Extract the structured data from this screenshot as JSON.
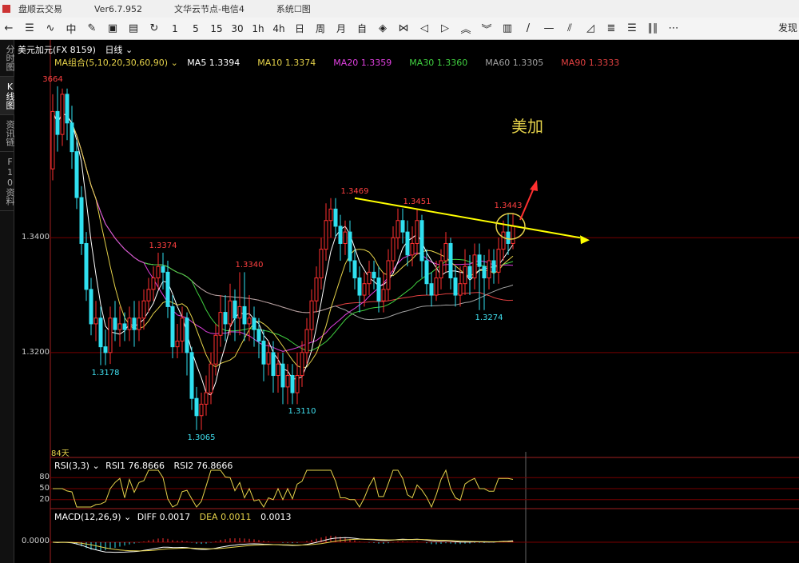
{
  "titlebar": {
    "app_title": "盘顺云交易",
    "version": "Ver6.7.952",
    "server": "文华云节点-电信4",
    "menu": "系统☐图"
  },
  "toolbar": {
    "buttons": [
      {
        "name": "back-button",
        "label": "←"
      },
      {
        "name": "list-button",
        "label": "☰"
      },
      {
        "name": "line-chart-button",
        "label": "∿"
      },
      {
        "name": "candle-button",
        "label": "中"
      },
      {
        "name": "draw-button",
        "label": "✎"
      },
      {
        "name": "screen-button",
        "label": "▣"
      },
      {
        "name": "save-button",
        "label": "▤"
      },
      {
        "name": "refresh-button",
        "label": "↻"
      }
    ],
    "periods": [
      "1",
      "5",
      "15",
      "30",
      "1h",
      "4h",
      "日",
      "周",
      "月",
      "自"
    ],
    "tools": [
      {
        "name": "crosshair-button",
        "label": "◈"
      },
      {
        "name": "split-button",
        "label": "⋈"
      },
      {
        "name": "left-button",
        "label": "◁"
      },
      {
        "name": "right-button",
        "label": "▷"
      },
      {
        "name": "up-button",
        "label": "︽"
      },
      {
        "name": "down-button",
        "label": "︾"
      },
      {
        "name": "layout-button",
        "label": "▥"
      },
      {
        "name": "line-tool-button",
        "label": "/"
      },
      {
        "name": "hline-tool-button",
        "label": "—"
      },
      {
        "name": "channel-tool-button",
        "label": "⫽"
      },
      {
        "name": "fib-tool-button",
        "label": "◿"
      },
      {
        "name": "grid-tool-button",
        "label": "≣"
      },
      {
        "name": "lines-tool-button",
        "label": "☰"
      },
      {
        "name": "bars-tool-button",
        "label": "∥∥"
      },
      {
        "name": "more-button",
        "label": "⋯"
      }
    ],
    "right_label": "发现"
  },
  "sidetabs": [
    {
      "label": "分时图",
      "active": false
    },
    {
      "label": "K线图",
      "active": true
    },
    {
      "label": "资讯链",
      "active": false
    },
    {
      "label": "F10资料",
      "active": false
    }
  ],
  "header": {
    "symbol": "美元加元(FX 8159)",
    "period": "日线",
    "ma_group": "MA组合(5,10,20,30,60,90)",
    "ma_items": [
      {
        "label": "MA5 1.3394",
        "color": "#ffffff"
      },
      {
        "label": "MA10 1.3374",
        "color": "#e5d24a"
      },
      {
        "label": "MA20 1.3359",
        "color": "#e040e0"
      },
      {
        "label": "MA30 1.3360",
        "color": "#40d040"
      },
      {
        "label": "MA60 1.3305",
        "color": "#a0a0a0"
      },
      {
        "label": "MA90 1.3333",
        "color": "#e04040"
      }
    ]
  },
  "annotation": {
    "title": "美加",
    "days": "84天"
  },
  "rsi": {
    "label": "RSI(3,3)",
    "rsi1": "RSI1 76.8666",
    "rsi2": "RSI2 76.8666",
    "ticks": [
      "80",
      "50",
      "20"
    ]
  },
  "macd": {
    "label": "MACD(12,26,9)",
    "diff": "DIFF 0.0017",
    "dea": "DEA 0.0011",
    "macd": "0.0013",
    "zero": "0.0000"
  },
  "chart_data": {
    "type": "candlestick",
    "y_ticks": [
      1.34,
      1.32
    ],
    "y_tick_labels": [
      "1.3400",
      "1.3200"
    ],
    "ylim": [
      1.302,
      1.37
    ],
    "price_labels": [
      {
        "text": "3664",
        "index": 0,
        "value": 1.3664,
        "pos": "top",
        "color": "#ff4040"
      },
      {
        "text": "1.3178",
        "index": 11,
        "value": 1.3178,
        "pos": "bottom",
        "color": "#40e0f0"
      },
      {
        "text": "1.3374",
        "index": 23,
        "value": 1.3374,
        "pos": "top",
        "color": "#ff4040"
      },
      {
        "text": "1.3065",
        "index": 31,
        "value": 1.3065,
        "pos": "bottom",
        "color": "#40e0f0"
      },
      {
        "text": "1.3340",
        "index": 41,
        "value": 1.334,
        "pos": "top",
        "color": "#ff4040"
      },
      {
        "text": "1.3110",
        "index": 52,
        "value": 1.311,
        "pos": "bottom",
        "color": "#40e0f0"
      },
      {
        "text": "1.3469",
        "index": 63,
        "value": 1.3469,
        "pos": "top",
        "color": "#ff4040"
      },
      {
        "text": "1.3451",
        "index": 76,
        "value": 1.3451,
        "pos": "top",
        "color": "#ff4040"
      },
      {
        "text": "1.3274",
        "index": 91,
        "value": 1.3274,
        "pos": "bottom",
        "color": "#40e0f0"
      },
      {
        "text": "1.3443",
        "index": 95,
        "value": 1.3443,
        "pos": "top",
        "color": "#ff4040"
      }
    ],
    "candles": [
      [
        1.352,
        1.362,
        1.365,
        1.35
      ],
      [
        1.362,
        1.358,
        1.3664,
        1.355
      ],
      [
        1.358,
        1.365,
        1.366,
        1.356
      ],
      [
        1.365,
        1.36,
        1.366,
        1.357
      ],
      [
        1.36,
        1.355,
        1.363,
        1.352
      ],
      [
        1.355,
        1.347,
        1.357,
        1.345
      ],
      [
        1.347,
        1.339,
        1.349,
        1.337
      ],
      [
        1.339,
        1.331,
        1.341,
        1.329
      ],
      [
        1.331,
        1.325,
        1.333,
        1.323
      ],
      [
        1.325,
        1.326,
        1.329,
        1.322
      ],
      [
        1.326,
        1.321,
        1.328,
        1.3178
      ],
      [
        1.321,
        1.32,
        1.324,
        1.3178
      ],
      [
        1.32,
        1.326,
        1.328,
        1.318
      ],
      [
        1.326,
        1.324,
        1.329,
        1.322
      ],
      [
        1.324,
        1.325,
        1.328,
        1.321
      ],
      [
        1.325,
        1.324,
        1.327,
        1.322
      ],
      [
        1.324,
        1.326,
        1.328,
        1.322
      ],
      [
        1.326,
        1.324,
        1.329,
        1.321
      ],
      [
        1.324,
        1.326,
        1.329,
        1.322
      ],
      [
        1.326,
        1.329,
        1.331,
        1.324
      ],
      [
        1.329,
        1.331,
        1.333,
        1.327
      ],
      [
        1.331,
        1.333,
        1.335,
        1.329
      ],
      [
        1.333,
        1.335,
        1.3374,
        1.331
      ],
      [
        1.335,
        1.334,
        1.3374,
        1.331
      ],
      [
        1.334,
        1.328,
        1.336,
        1.326
      ],
      [
        1.328,
        1.321,
        1.33,
        1.319
      ],
      [
        1.321,
        1.322,
        1.325,
        1.319
      ],
      [
        1.322,
        1.326,
        1.328,
        1.32
      ],
      [
        1.326,
        1.32,
        1.327,
        1.316
      ],
      [
        1.32,
        1.312,
        1.321,
        1.31
      ],
      [
        1.312,
        1.309,
        1.314,
        1.3065
      ],
      [
        1.309,
        1.311,
        1.313,
        1.3065
      ],
      [
        1.311,
        1.313,
        1.316,
        1.309
      ],
      [
        1.313,
        1.318,
        1.32,
        1.311
      ],
      [
        1.318,
        1.323,
        1.325,
        1.316
      ],
      [
        1.323,
        1.327,
        1.33,
        1.321
      ],
      [
        1.327,
        1.325,
        1.33,
        1.322
      ],
      [
        1.325,
        1.329,
        1.332,
        1.323
      ],
      [
        1.329,
        1.326,
        1.331,
        1.322
      ],
      [
        1.326,
        1.328,
        1.334,
        1.323
      ],
      [
        1.328,
        1.325,
        1.334,
        1.322
      ],
      [
        1.325,
        1.326,
        1.33,
        1.322
      ],
      [
        1.326,
        1.324,
        1.328,
        1.321
      ],
      [
        1.324,
        1.322,
        1.326,
        1.319
      ],
      [
        1.322,
        1.318,
        1.324,
        1.315
      ],
      [
        1.318,
        1.32,
        1.322,
        1.316
      ],
      [
        1.32,
        1.316,
        1.322,
        1.313
      ],
      [
        1.316,
        1.318,
        1.32,
        1.313
      ],
      [
        1.318,
        1.314,
        1.32,
        1.311
      ],
      [
        1.314,
        1.316,
        1.318,
        1.311
      ],
      [
        1.316,
        1.313,
        1.318,
        1.311
      ],
      [
        1.313,
        1.316,
        1.32,
        1.311
      ],
      [
        1.316,
        1.32,
        1.322,
        1.314
      ],
      [
        1.32,
        1.324,
        1.326,
        1.318
      ],
      [
        1.324,
        1.329,
        1.331,
        1.322
      ],
      [
        1.329,
        1.333,
        1.335,
        1.327
      ],
      [
        1.333,
        1.338,
        1.34,
        1.331
      ],
      [
        1.338,
        1.343,
        1.346,
        1.336
      ],
      [
        1.343,
        1.345,
        1.3469,
        1.34
      ],
      [
        1.345,
        1.342,
        1.3469,
        1.34
      ],
      [
        1.342,
        1.339,
        1.344,
        1.336
      ],
      [
        1.339,
        1.341,
        1.343,
        1.337
      ],
      [
        1.341,
        1.336,
        1.343,
        1.334
      ],
      [
        1.336,
        1.333,
        1.338,
        1.331
      ],
      [
        1.333,
        1.33,
        1.335,
        1.327
      ],
      [
        1.33,
        1.332,
        1.334,
        1.328
      ],
      [
        1.332,
        1.334,
        1.336,
        1.33
      ],
      [
        1.334,
        1.333,
        1.336,
        1.331
      ],
      [
        1.333,
        1.329,
        1.335,
        1.327
      ],
      [
        1.329,
        1.331,
        1.334,
        1.327
      ],
      [
        1.331,
        1.336,
        1.338,
        1.329
      ],
      [
        1.336,
        1.34,
        1.342,
        1.334
      ],
      [
        1.34,
        1.343,
        1.3451,
        1.338
      ],
      [
        1.343,
        1.341,
        1.3451,
        1.339
      ],
      [
        1.341,
        1.337,
        1.343,
        1.335
      ],
      [
        1.337,
        1.339,
        1.342,
        1.335
      ],
      [
        1.339,
        1.343,
        1.3451,
        1.337
      ],
      [
        1.343,
        1.336,
        1.344,
        1.333
      ],
      [
        1.336,
        1.332,
        1.338,
        1.33
      ],
      [
        1.332,
        1.33,
        1.334,
        1.328
      ],
      [
        1.33,
        1.333,
        1.336,
        1.329
      ],
      [
        1.333,
        1.336,
        1.338,
        1.331
      ],
      [
        1.336,
        1.339,
        1.341,
        1.334
      ],
      [
        1.339,
        1.333,
        1.34,
        1.331
      ],
      [
        1.333,
        1.33,
        1.335,
        1.328
      ],
      [
        1.33,
        1.332,
        1.335,
        1.328
      ],
      [
        1.332,
        1.335,
        1.338,
        1.33
      ],
      [
        1.335,
        1.333,
        1.337,
        1.33
      ],
      [
        1.333,
        1.337,
        1.339,
        1.331
      ],
      [
        1.337,
        1.335,
        1.339,
        1.3274
      ],
      [
        1.335,
        1.333,
        1.337,
        1.3274
      ],
      [
        1.333,
        1.336,
        1.338,
        1.331
      ],
      [
        1.336,
        1.334,
        1.338,
        1.332
      ],
      [
        1.334,
        1.338,
        1.34,
        1.332
      ],
      [
        1.338,
        1.341,
        1.343,
        1.336
      ],
      [
        1.341,
        1.339,
        1.3443,
        1.337
      ],
      [
        1.339,
        1.342,
        1.3443,
        1.338
      ]
    ],
    "trendline": {
      "from_index": 63,
      "from_value": 1.3469,
      "to_index": 110,
      "to_value": 1.34,
      "color": "#ffff00"
    },
    "ma_colors": {
      "ma5": "#ffffff",
      "ma10": "#e5d24a",
      "ma20": "#e040e0",
      "ma30": "#40d040",
      "ma60": "#a0a0a0",
      "ma90": "#e04040"
    },
    "up_color": "#ff3030",
    "down_color": "#30e0f0",
    "rsi_ticks": [
      80,
      50,
      20
    ],
    "rsi_color": "#e5d24a"
  }
}
